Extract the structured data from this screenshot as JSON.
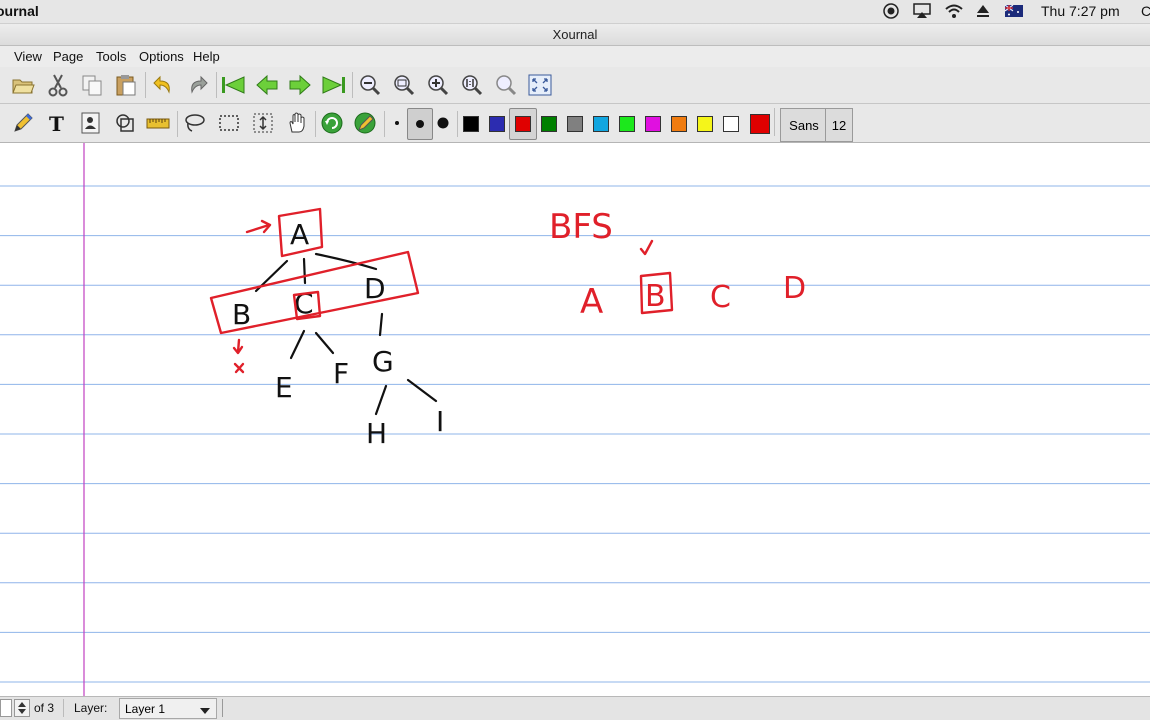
{
  "system_bar": {
    "app_name": "ournal",
    "clock": "Thu 7:27 pm",
    "edge_char": "C",
    "icons": [
      "record-icon",
      "airplay-icon",
      "wifi-icon",
      "eject-icon",
      "flag-icon"
    ]
  },
  "window": {
    "title": "Xournal"
  },
  "menu": {
    "items": [
      "View",
      "Page",
      "Tools",
      "Options",
      "Help"
    ]
  },
  "toolbar_main": {
    "icons": [
      "open-icon",
      "cut-icon",
      "copy-icon",
      "paste-icon",
      "undo-icon",
      "redo-icon",
      "first-page-icon",
      "previous-page-icon",
      "next-page-icon",
      "last-page-icon",
      "zoom-out-icon",
      "zoom-fit-icon",
      "zoom-in-icon",
      "zoom-100-icon",
      "zoom-set-icon",
      "fullscreen-icon"
    ]
  },
  "toolbar_pen": {
    "tools": [
      "pen-icon",
      "text-icon",
      "image-icon",
      "shape-recognizer-icon",
      "ruler-icon",
      "lasso-icon",
      "rect-select-icon",
      "vertical-space-icon",
      "hand-icon",
      "default-tool-icon",
      "default-pen-icon"
    ],
    "thickness": [
      "fine",
      "medium",
      "thick"
    ],
    "selected_thickness": "medium",
    "colors": [
      "#000000",
      "#2c2cb0",
      "#e00000",
      "#008000",
      "#808080",
      "#12a6e0",
      "#1ce81c",
      "#e010e0",
      "#f07c10",
      "#f5f51a",
      "#ffffff"
    ],
    "selected_color": "#e00000",
    "current_color": "#e00000",
    "font_name": "Sans",
    "font_size": "12"
  },
  "page": {
    "ruled_line_color": "#8fb4ea",
    "margin_line_color": "#c040c0",
    "black_ink": "#111111",
    "red_ink": "#e0202a",
    "tree_node_labels": [
      "A",
      "B",
      "C",
      "D",
      "E",
      "F",
      "G",
      "H",
      "I"
    ],
    "bfs_heading": "BFS",
    "bfs_queue": [
      "A",
      "B",
      "C",
      "D"
    ]
  },
  "status": {
    "page_of": "of 3",
    "layer_label": "Layer:",
    "layer_value": "Layer 1"
  }
}
